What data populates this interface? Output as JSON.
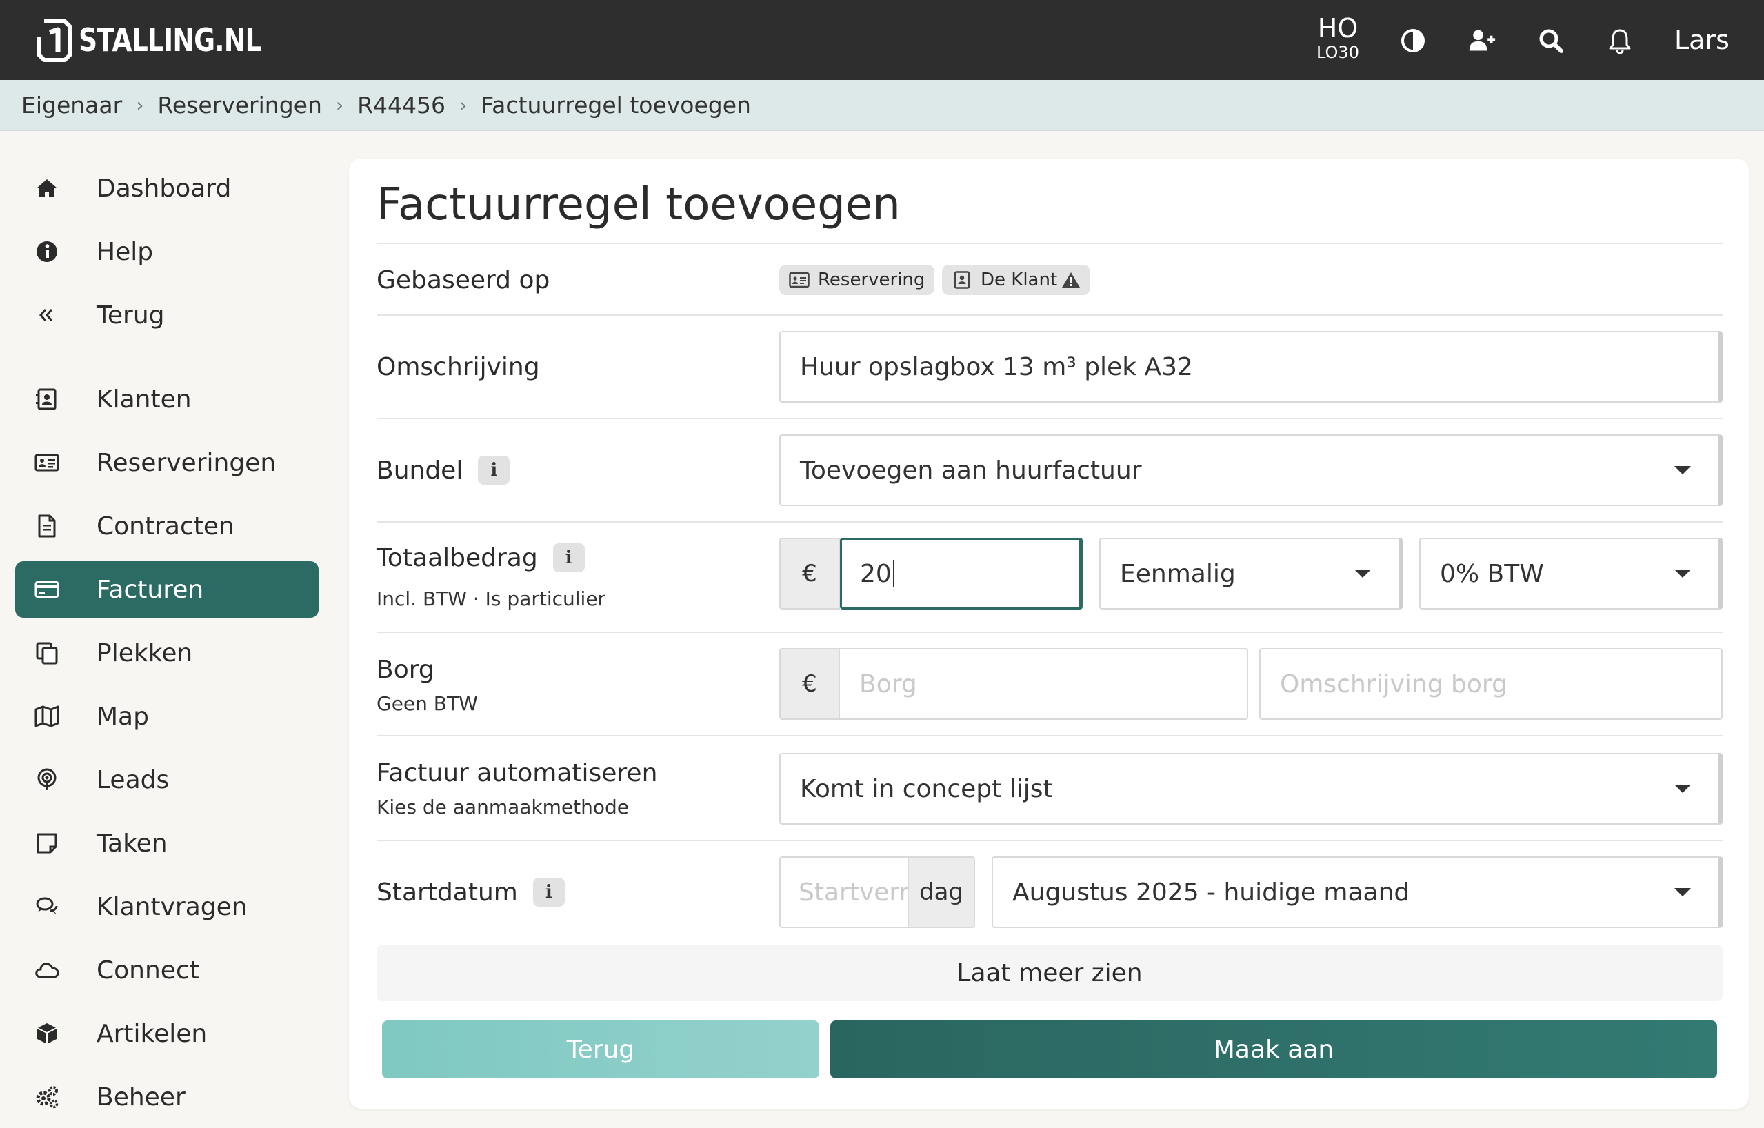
{
  "header": {
    "brand": "STALLING.NL",
    "location_code": "HO",
    "location_sub": "LO30",
    "user_name": "Lars"
  },
  "breadcrumb": [
    "Eigenaar",
    "Reserveringen",
    "R44456",
    "Factuurregel toevoegen"
  ],
  "sidebar": {
    "items": [
      {
        "label": "Dashboard",
        "icon": "home-icon"
      },
      {
        "label": "Help",
        "icon": "info-circle-icon"
      },
      {
        "label": "Terug",
        "icon": "double-chevron-left-icon"
      },
      {
        "label": "Klanten",
        "icon": "contact-card-icon"
      },
      {
        "label": "Reserveringen",
        "icon": "id-card-icon"
      },
      {
        "label": "Contracten",
        "icon": "document-icon"
      },
      {
        "label": "Facturen",
        "icon": "credit-card-icon",
        "active": true
      },
      {
        "label": "Plekken",
        "icon": "copy-icon"
      },
      {
        "label": "Map",
        "icon": "map-icon"
      },
      {
        "label": "Leads",
        "icon": "podcast-icon"
      },
      {
        "label": "Taken",
        "icon": "note-icon"
      },
      {
        "label": "Klantvragen",
        "icon": "comments-icon"
      },
      {
        "label": "Connect",
        "icon": "cloud-icon"
      },
      {
        "label": "Artikelen",
        "icon": "box-icon"
      },
      {
        "label": "Beheer",
        "icon": "cogs-icon"
      }
    ]
  },
  "form": {
    "title": "Factuurregel toevoegen",
    "based_on": {
      "label": "Gebaseerd op",
      "chips": [
        "Reservering",
        "De Klant"
      ]
    },
    "description": {
      "label": "Omschrijving",
      "value": "Huur opslagbox 13 m³ plek A32"
    },
    "bundle": {
      "label": "Bundel",
      "value": "Toevoegen aan huurfactuur"
    },
    "total": {
      "label": "Totaalbedrag",
      "sublabel": "Incl. BTW · Is particulier",
      "currency": "€",
      "value": "20",
      "frequency": "Eenmalig",
      "vat": "0% BTW"
    },
    "deposit": {
      "label": "Borg",
      "sublabel": "Geen BTW",
      "currency": "€",
      "placeholder": "Borg",
      "description_placeholder": "Omschrijving borg"
    },
    "automate": {
      "label": "Factuur automatiseren",
      "sublabel": "Kies de aanmaakmethode",
      "value": "Komt in concept lijst"
    },
    "start": {
      "label": "Startdatum",
      "placeholder": "Startverr",
      "unit": "dag",
      "value": "Augustus 2025 - huidige maand"
    },
    "show_more": "Laat meer zien",
    "back_button": "Terug",
    "create_button": "Maak aan"
  },
  "colors": {
    "topbar": "#2e2e2e",
    "breadcrumb_bg": "#dde9e9",
    "accent": "#2c6b64",
    "accent_light": "#7fc8c2"
  }
}
